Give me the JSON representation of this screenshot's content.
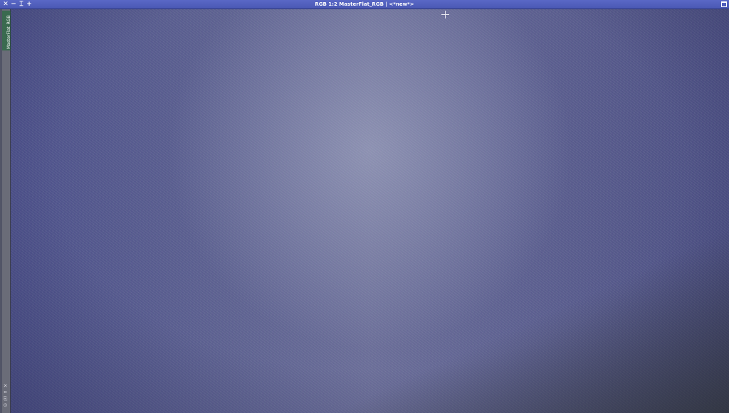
{
  "window": {
    "title": "RGB 1:2 MasterFlat_RGB | <*new*>",
    "controls": {
      "close_icon": "✕",
      "minimize_icon": "−",
      "shade_icon": "⌶",
      "restore_icon": "+"
    }
  },
  "sidebar": {
    "view_tab_label": "MasterFlat_RGB",
    "tools": [
      "✕",
      "⌗",
      "⎘",
      "⊙"
    ]
  },
  "image": {
    "description_colors": {
      "base": "#5a5e90",
      "center_highlight": "#9ea3c4",
      "corner_shadow": "#3b3f2c"
    }
  }
}
